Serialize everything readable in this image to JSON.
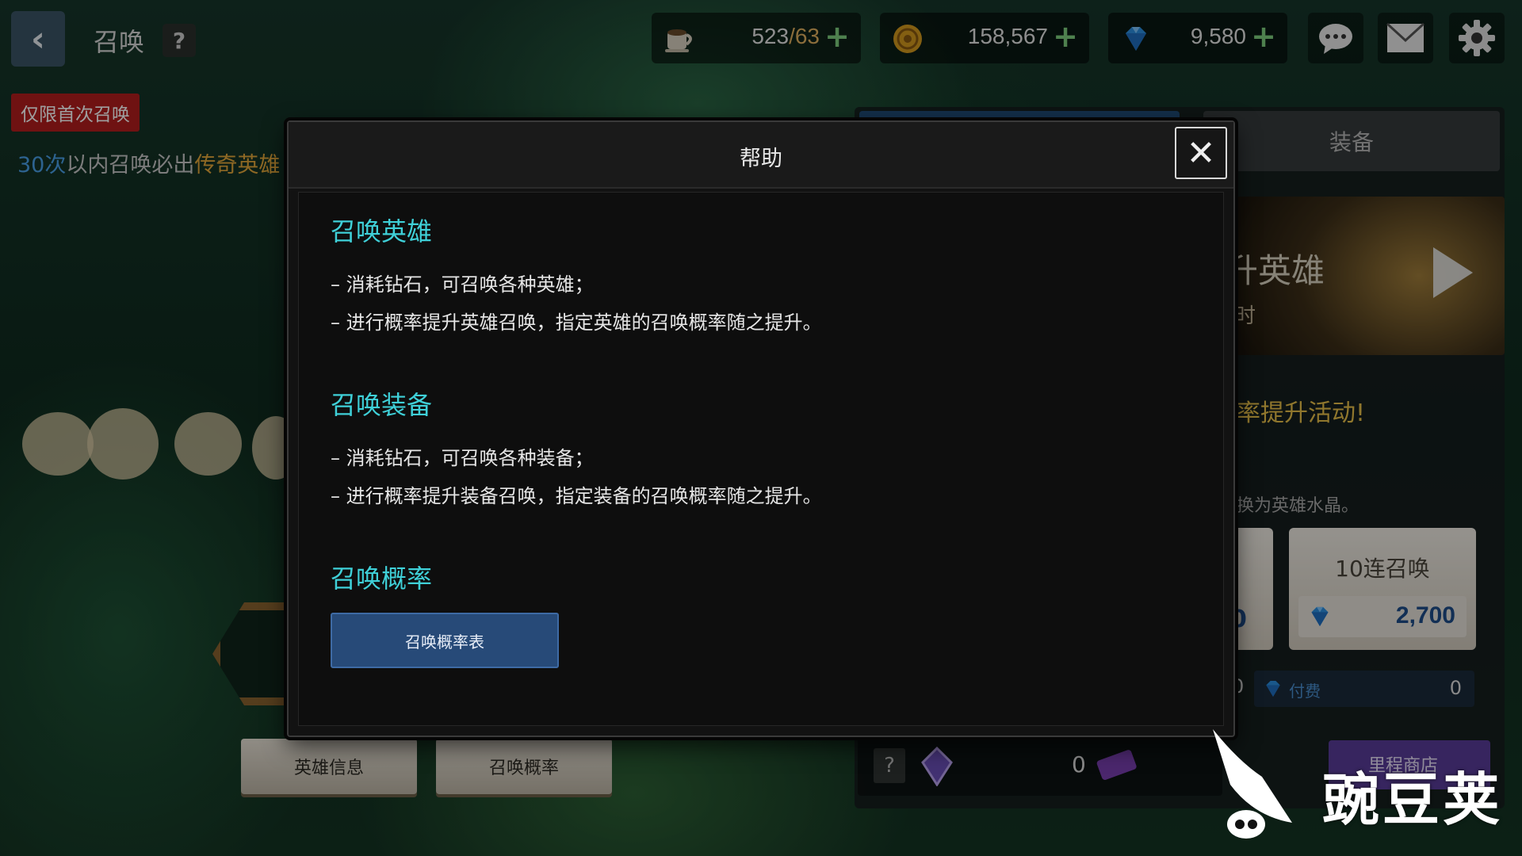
{
  "header": {
    "title": "召唤",
    "help_icon": "?",
    "resources": [
      {
        "icon": "coffee-cup-icon",
        "value": "523",
        "sub": "/63",
        "plus": "+"
      },
      {
        "icon": "gold-coin-icon",
        "value": "158,567",
        "plus": "+"
      },
      {
        "icon": "diamond-icon",
        "value": "9,580",
        "plus": "+"
      }
    ],
    "buttons": [
      "chat-icon",
      "mail-icon",
      "gear-icon"
    ]
  },
  "left": {
    "first_badge": "仅限首次召唤",
    "guarantee_prefix": "30次",
    "guarantee_mid": "以内召唤必出",
    "guarantee_suffix": "传奇英雄",
    "bottom_buttons": [
      "英雄信息",
      "召唤概率"
    ]
  },
  "right": {
    "tab_equip": "装备",
    "banner_title": "升英雄",
    "banner_sub": "时",
    "promo": "率提升活动!",
    "promo_desc": "换为英雄水晶。",
    "card_partial_cost": "0",
    "card_ten_title": "10连召唤",
    "card_ten_cost": "2,700",
    "paid_left_value": "0",
    "paid_label": "付费",
    "paid_value": "0",
    "bottom_q": "?",
    "bottom_count": "0",
    "shop_label": "里程商店"
  },
  "modal": {
    "title": "帮助",
    "close_icon": "✕",
    "sections": [
      {
        "title": "召唤英雄",
        "lines": [
          "–  消耗钻石，可召唤各种英雄；",
          "–  进行概率提升英雄召唤，指定英雄的召唤概率随之提升。"
        ]
      },
      {
        "title": "召唤装备",
        "lines": [
          "–  消耗钻石，可召唤各种装备；",
          "–  进行概率提升装备召唤，指定装备的召唤概率随之提升。"
        ]
      },
      {
        "title": "召唤概率",
        "lines": []
      }
    ],
    "rate_table_button": "召唤概率表"
  },
  "watermark": {
    "text": "豌豆荚"
  },
  "colors": {
    "accent_cyan": "#3fd0d8",
    "diamond_blue": "#2a8fe0",
    "gold": "#e6a93a",
    "badge_red": "#b41e1e"
  }
}
